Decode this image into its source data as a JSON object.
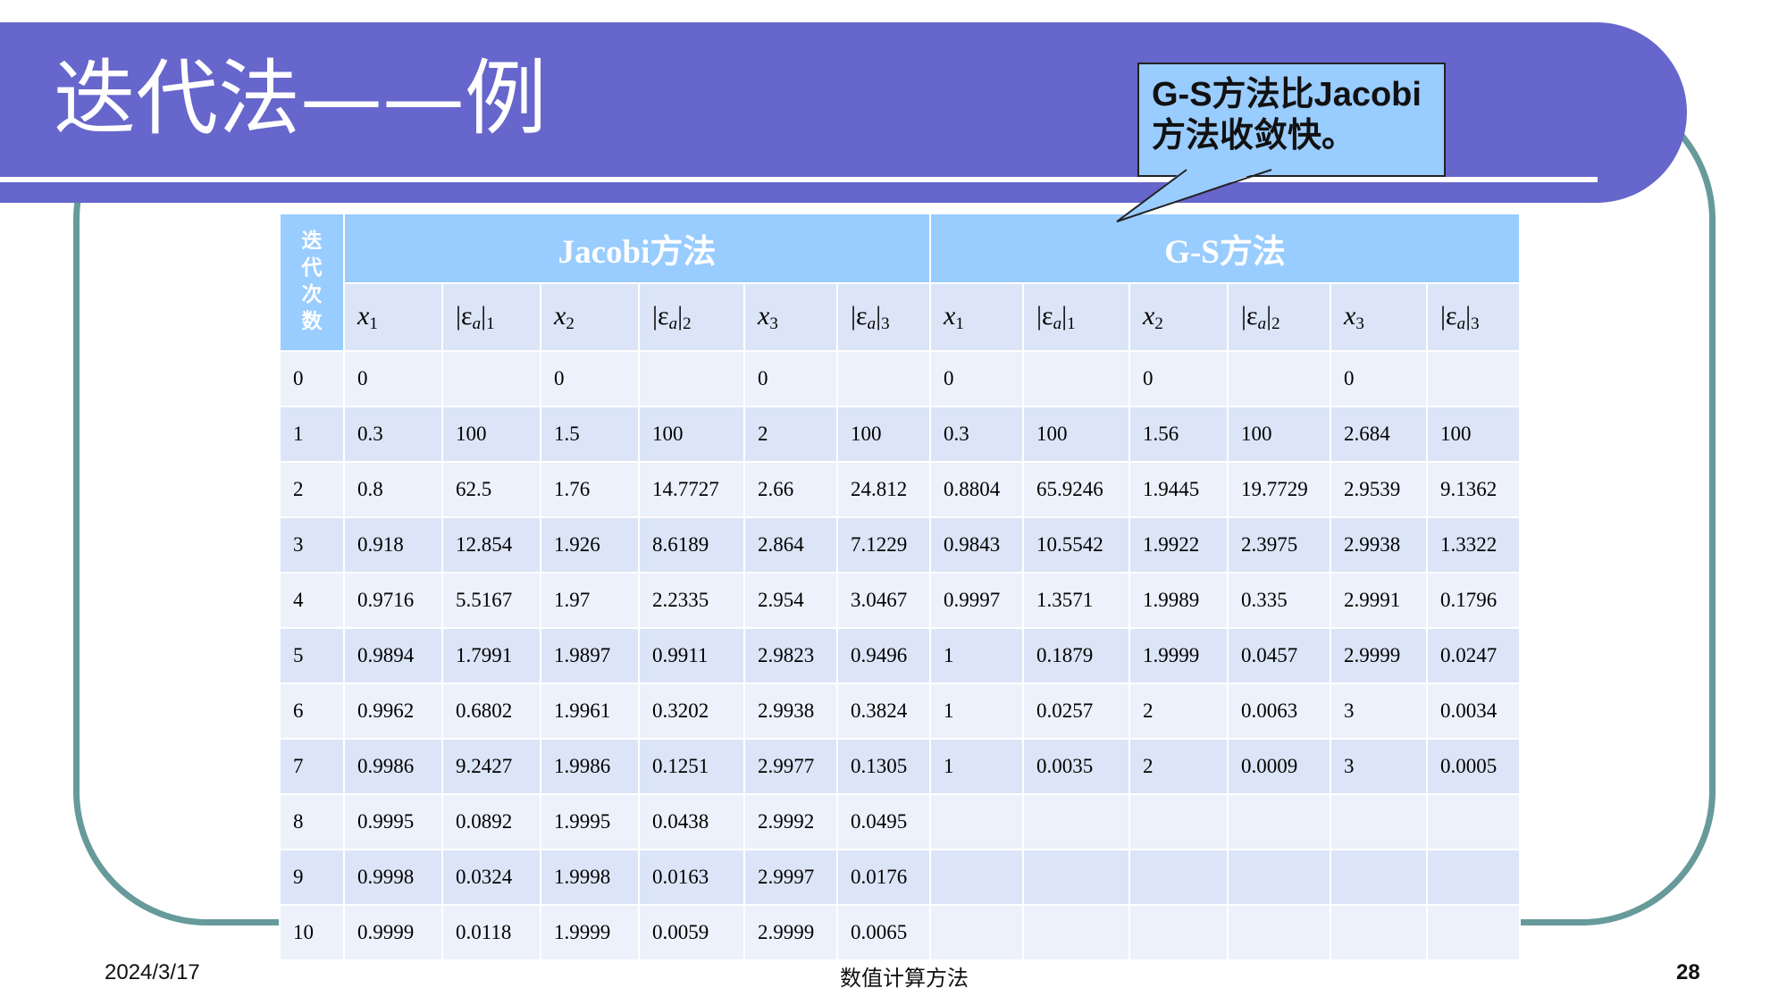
{
  "title": "迭代法——例",
  "callout": {
    "line1": "G-S方法比Jacobi",
    "line2": "方法收敛快。"
  },
  "table": {
    "iter_header": [
      "迭",
      "代",
      "次",
      "数"
    ],
    "group_headers": [
      "Jacobi方法",
      "G-S方法"
    ],
    "sub_headers": [
      {
        "var": "x",
        "sub": "1"
      },
      {
        "var": "|ε",
        "vsub": "a",
        "bar": "|",
        "sub": "1"
      },
      {
        "var": "x",
        "sub": "2"
      },
      {
        "var": "|ε",
        "vsub": "a",
        "bar": "|",
        "sub": "2"
      },
      {
        "var": "x",
        "sub": "3"
      },
      {
        "var": "|ε",
        "vsub": "a",
        "bar": "|",
        "sub": "3"
      },
      {
        "var": "x",
        "sub": "1"
      },
      {
        "var": "|ε",
        "vsub": "a",
        "bar": "|",
        "sub": "1"
      },
      {
        "var": "x",
        "sub": "2"
      },
      {
        "var": "|ε",
        "vsub": "a",
        "bar": "|",
        "sub": "2"
      },
      {
        "var": "x",
        "sub": "3"
      },
      {
        "var": "|ε",
        "vsub": "a",
        "bar": "|",
        "sub": "3"
      }
    ],
    "rows": [
      [
        "0",
        "0",
        "",
        "0",
        "",
        "0",
        "",
        "0",
        "",
        "0",
        "",
        "0",
        ""
      ],
      [
        "1",
        "0.3",
        "100",
        "1.5",
        "100",
        "2",
        "100",
        "0.3",
        "100",
        "1.56",
        "100",
        "2.684",
        "100"
      ],
      [
        "2",
        "0.8",
        "62.5",
        "1.76",
        "14.7727",
        "2.66",
        "24.812",
        "0.8804",
        "65.9246",
        "1.9445",
        "19.7729",
        "2.9539",
        "9.1362"
      ],
      [
        "3",
        "0.918",
        "12.854",
        "1.926",
        "8.6189",
        "2.864",
        "7.1229",
        "0.9843",
        "10.5542",
        "1.9922",
        "2.3975",
        "2.9938",
        "1.3322"
      ],
      [
        "4",
        "0.9716",
        "5.5167",
        "1.97",
        "2.2335",
        "2.954",
        "3.0467",
        "0.9997",
        "1.3571",
        "1.9989",
        "0.335",
        "2.9991",
        "0.1796"
      ],
      [
        "5",
        "0.9894",
        "1.7991",
        "1.9897",
        "0.9911",
        "2.9823",
        "0.9496",
        "1",
        "0.1879",
        "1.9999",
        "0.0457",
        "2.9999",
        "0.0247"
      ],
      [
        "6",
        "0.9962",
        "0.6802",
        "1.9961",
        "0.3202",
        "2.9938",
        "0.3824",
        "1",
        "0.0257",
        "2",
        "0.0063",
        "3",
        "0.0034"
      ],
      [
        "7",
        "0.9986",
        "9.2427",
        "1.9986",
        "0.1251",
        "2.9977",
        "0.1305",
        "1",
        "0.0035",
        "2",
        "0.0009",
        "3",
        "0.0005"
      ],
      [
        "8",
        "0.9995",
        "0.0892",
        "1.9995",
        "0.0438",
        "2.9992",
        "0.0495",
        "",
        "",
        "",
        "",
        "",
        ""
      ],
      [
        "9",
        "0.9998",
        "0.0324",
        "1.9998",
        "0.0163",
        "2.9997",
        "0.0176",
        "",
        "",
        "",
        "",
        "",
        ""
      ],
      [
        "10",
        "0.9999",
        "0.0118",
        "1.9999",
        "0.0059",
        "2.9999",
        "0.0065",
        "",
        "",
        "",
        "",
        "",
        ""
      ]
    ]
  },
  "footer": {
    "date": "2024/3/17",
    "center": "数值计算方法",
    "page": "28"
  },
  "colors": {
    "banner": "#6666cc",
    "frame": "#679a9a",
    "header_blue": "#99ccff",
    "row_light": "#ecf1fb",
    "row_dark": "#dbe5f7"
  }
}
